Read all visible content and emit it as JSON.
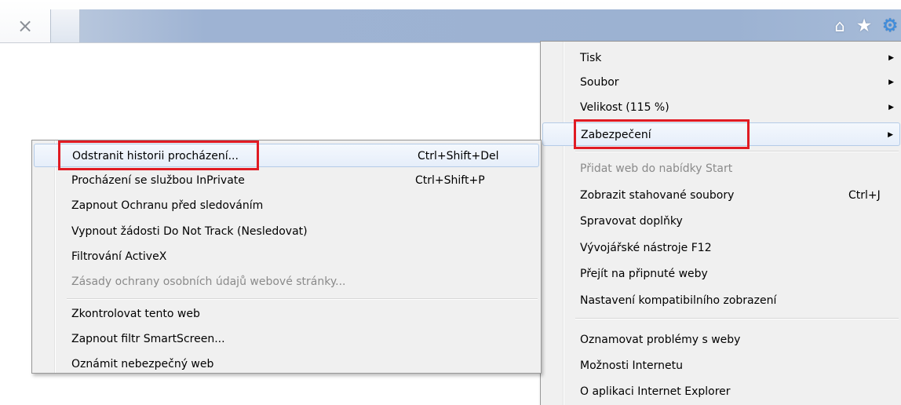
{
  "browser": {
    "close_glyph": "×",
    "toolbar_icons": [
      "home-icon",
      "star-icon",
      "gear-icon"
    ],
    "gear_color": "#3d8ee0"
  },
  "tools_menu": {
    "items": [
      {
        "label": "Tisk",
        "has_submenu": true
      },
      {
        "label": "Soubor",
        "has_submenu": true
      },
      {
        "label": "Velikost (115 %)",
        "has_submenu": true
      },
      {
        "label": "Zabezpečení",
        "has_submenu": true
      },
      {
        "label": "Přidat web do nabídky Start",
        "disabled": true
      },
      {
        "label": "Zobrazit stahované soubory",
        "shortcut": "Ctrl+J"
      },
      {
        "label": "Spravovat doplňky"
      },
      {
        "label": "Vývojářské nástroje F12"
      },
      {
        "label": "Přejít na připnuté weby"
      },
      {
        "label": "Nastavení kompatibilního zobrazení"
      },
      {
        "label": "Oznamovat problémy s weby"
      },
      {
        "label": "Možnosti Internetu"
      },
      {
        "label": "O aplikaci Internet Explorer"
      }
    ]
  },
  "safety_menu": {
    "items": [
      {
        "label": "Odstranit historii procházení...",
        "shortcut": "Ctrl+Shift+Del"
      },
      {
        "label": "Procházení se službou InPrivate",
        "shortcut": "Ctrl+Shift+P"
      },
      {
        "label": "Zapnout Ochranu před sledováním"
      },
      {
        "label": "Vypnout žádosti Do Not Track (Nesledovat)"
      },
      {
        "label": "Filtrování ActiveX"
      },
      {
        "label": "Zásady ochrany osobních údajů webové stránky...",
        "disabled": true
      },
      {
        "label": "Zkontrolovat tento web"
      },
      {
        "label": "Zapnout filtr SmartScreen..."
      },
      {
        "label": "Oznámit nebezpečný web"
      }
    ]
  },
  "annotation": {
    "highlight_color": "#e01b24"
  }
}
